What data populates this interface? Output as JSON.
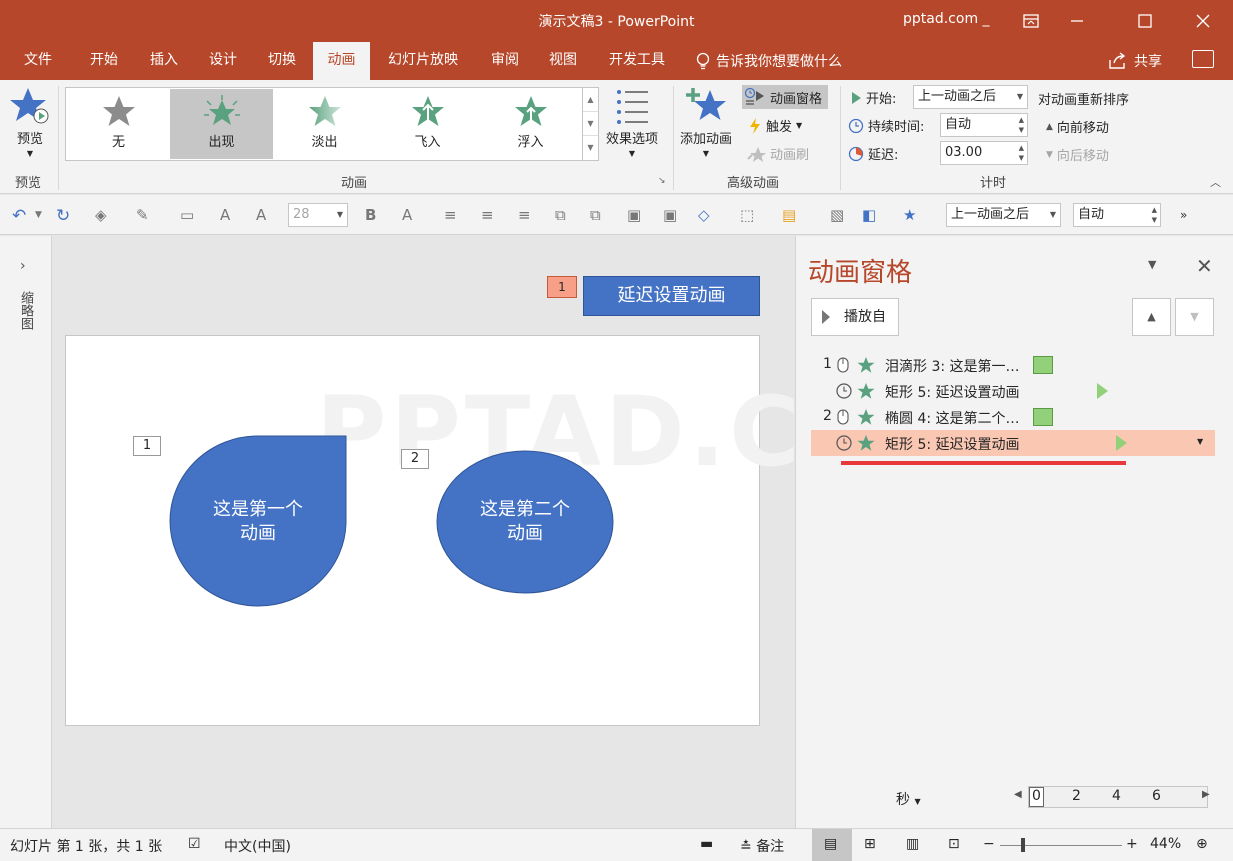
{
  "app": {
    "title": "演示文稿3  -  PowerPoint",
    "account": "pptad.com"
  },
  "menu": {
    "tabs": [
      "文件",
      "开始",
      "插入",
      "设计",
      "切换",
      "动画",
      "幻灯片放映",
      "审阅",
      "视图",
      "开发工具"
    ],
    "active_tab": "动画",
    "tell_me": "告诉我你想要做什么",
    "share": "共享"
  },
  "ribbon": {
    "preview": {
      "label": "预览",
      "group": "预览"
    },
    "gallery": {
      "items": [
        "无",
        "出现",
        "淡出",
        "飞入",
        "浮入"
      ],
      "selected": "出现",
      "group": "动画"
    },
    "effect_options": "效果选项",
    "advanced": {
      "add_animation": "添加动画",
      "animation_pane": "动画窗格",
      "trigger": "触发",
      "painter": "动画刷",
      "group": "高级动画"
    },
    "timing": {
      "start_label": "开始:",
      "start_value": "上一动画之后",
      "duration_label": "持续时间:",
      "duration_value": "自动",
      "delay_label": "延迟:",
      "delay_value": "03.00",
      "reorder_title": "对动画重新排序",
      "move_earlier": "向前移动",
      "move_later": "向后移动",
      "group": "计时"
    }
  },
  "quickbar": {
    "font_size": "28",
    "start_value": "上一动画之后",
    "duration_value": "自动"
  },
  "thumbnails": {
    "label": "缩略图"
  },
  "slide": {
    "watermark": "PPTAD.COM",
    "shape1": {
      "tag": "1",
      "text_line1": "这是第一个",
      "text_line2": "动画"
    },
    "shape2": {
      "tag": "2",
      "text_line1": "这是第二个",
      "text_line2": "动画"
    },
    "trigger_button": "延迟设置动画",
    "trigger_badge": "1"
  },
  "pane": {
    "title": "动画窗格",
    "play_from": "播放自",
    "rows": [
      {
        "num": "1",
        "label": "泪滴形 3: 这是第一…",
        "marker": "bar"
      },
      {
        "num": "",
        "label": "矩形 5: 延迟设置动画",
        "marker": "play"
      },
      {
        "num": "2",
        "label": "椭圆 4: 这是第二个…",
        "marker": "bar"
      },
      {
        "num": "",
        "label": "矩形 5: 延迟设置动画",
        "marker": "play",
        "selected": true
      }
    ],
    "seconds_label": "秒",
    "timeline_ticks": [
      "0",
      "2",
      "4",
      "6"
    ]
  },
  "status": {
    "slide_info": "幻灯片 第 1 张，共 1 张",
    "language": "中文(中国)",
    "notes": "备注",
    "zoom": "44%"
  },
  "colors": {
    "accent": "#b7472a",
    "shape_fill": "#4472c4",
    "star_green": "#5aa17f",
    "selected_row": "#f9c7b2"
  }
}
